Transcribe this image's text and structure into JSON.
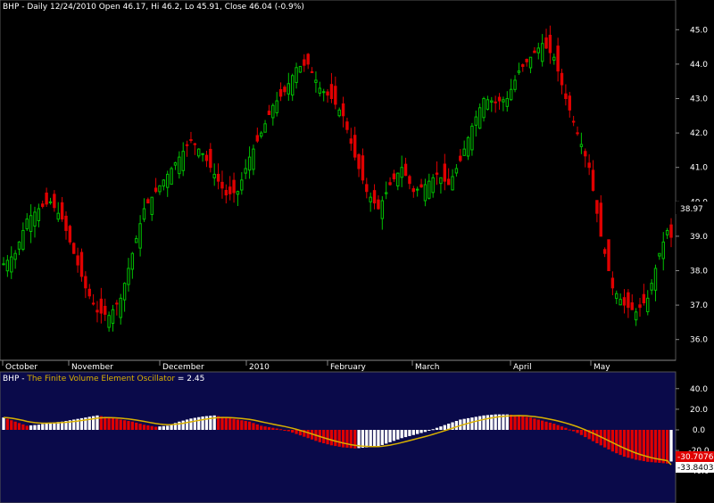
{
  "colors": {
    "background": "#000000",
    "up": "#00c000",
    "down": "#e00000",
    "osc_bg": "#0a0a4a",
    "osc_pos": "#ffffff",
    "osc_neg": "#e00000",
    "signal": "#d8b000",
    "axis_text": "#ffffff",
    "osc_title": "#d8b000"
  },
  "price_panel": {
    "title": "BHP - Daily 12/24/2010 Open 46.17, Hi 46.2, Lo 45.91, Close 46.04 (-0.9%)",
    "last_price_label": "38.97",
    "y_ticks": [
      "45.0",
      "44.0",
      "43.0",
      "42.0",
      "41.0",
      "40.0",
      "39.0",
      "38.0",
      "37.0",
      "36.0"
    ],
    "x_labels": [
      "October",
      "November",
      "December",
      "2010",
      "February",
      "March",
      "April",
      "May"
    ]
  },
  "osc_panel": {
    "title_prefix": "BHP - ",
    "title_name": "The Finite Volume Element Oscillator",
    "title_value": " = 2.45",
    "value_label": "-30.7076",
    "signal_label": "-33.8403",
    "y_ticks": [
      "40.0",
      "20.0",
      "0.0",
      "-20.0",
      "-40.0"
    ]
  },
  "chart_data": [
    {
      "type": "candlestick",
      "title": "BHP - Daily 12/24/2010 Open 46.17, Hi 46.2, Lo 45.91, Close 46.04 (-0.9%)",
      "ylim": [
        35.5,
        45.5
      ],
      "x_axis_labels": [
        "October",
        "November",
        "December",
        "2010",
        "February",
        "March",
        "April",
        "May"
      ],
      "anchor_closes": [
        38.2,
        38.5,
        39.5,
        39.8,
        40.0,
        39.5,
        38.5,
        37.5,
        36.8,
        36.7,
        37.2,
        38.5,
        39.8,
        40.3,
        40.8,
        41.3,
        41.8,
        41.4,
        40.8,
        40.2,
        40.3,
        41.3,
        42.0,
        42.8,
        43.2,
        43.9,
        44.0,
        43.3,
        43.0,
        42.5,
        41.3,
        40.3,
        39.8,
        40.5,
        41.0,
        40.3,
        40.5,
        40.8,
        40.5,
        41.2,
        42.2,
        43.0,
        42.9,
        43.0,
        43.8,
        44.2,
        44.6,
        44.2,
        43.0,
        42.0,
        41.0,
        39.0,
        37.5,
        37.0,
        36.8,
        37.2,
        38.5,
        39.5
      ],
      "last_close": 38.97
    },
    {
      "type": "bar",
      "title": "BHP - The Finite Volume Element Oscillator = 2.45",
      "ylim": [
        -45,
        45
      ],
      "anchor_values": [
        12,
        8,
        4,
        5,
        7,
        8,
        10,
        12,
        14,
        12,
        10,
        8,
        5,
        3,
        4,
        8,
        11,
        13,
        14,
        12,
        10,
        8,
        4,
        2,
        0,
        -4,
        -8,
        -12,
        -15,
        -17,
        -18,
        -17,
        -16,
        -12,
        -8,
        -5,
        -2,
        2,
        6,
        10,
        12,
        14,
        15,
        15,
        14,
        12,
        9,
        6,
        2,
        -3,
        -9,
        -15,
        -21,
        -26,
        -29,
        -31,
        -32,
        -33
      ],
      "last_value": -30.7076,
      "last_signal": -33.8403
    }
  ]
}
